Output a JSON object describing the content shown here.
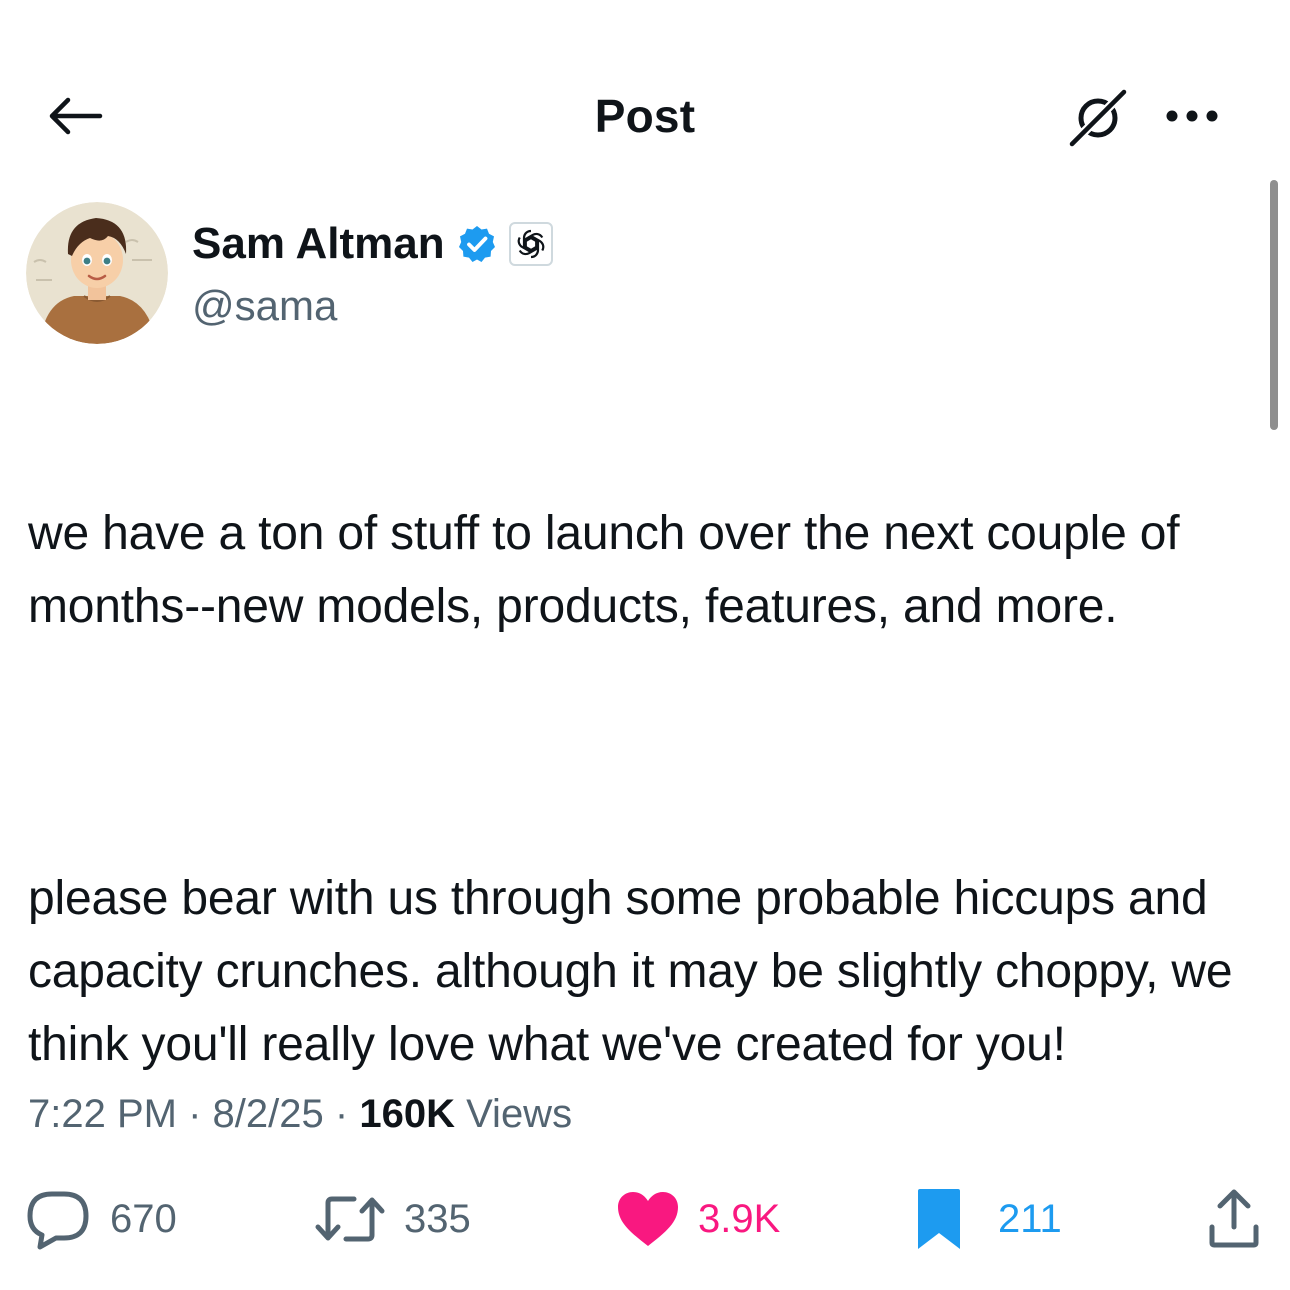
{
  "header": {
    "title": "Post",
    "back_icon": "arrow-left-icon",
    "grok_icon": "grok-icon",
    "more_icon": "ellipsis-icon"
  },
  "author": {
    "display_name": "Sam Altman",
    "handle": "@sama",
    "verified": true,
    "verified_color": "#1d9bf0",
    "affiliate_badge": "openai-logo-icon"
  },
  "post": {
    "text_paragraphs": [
      "we have a ton of stuff to launch over the next couple of months--new models, products, features, and more.",
      "please bear with us through some probable hiccups and capacity crunches. although it may be slightly choppy, we think you'll really love what we've created for you!"
    ]
  },
  "meta": {
    "time": "7:22 PM",
    "separator": "·",
    "date": "8/2/25",
    "views_count": "160K",
    "views_label": "Views"
  },
  "actions": {
    "replies": "670",
    "reposts": "335",
    "likes": "3.9K",
    "bookmarks": "211",
    "liked": true,
    "bookmarked": true,
    "like_color": "#f91880",
    "bookmark_color": "#1d9bf0"
  }
}
